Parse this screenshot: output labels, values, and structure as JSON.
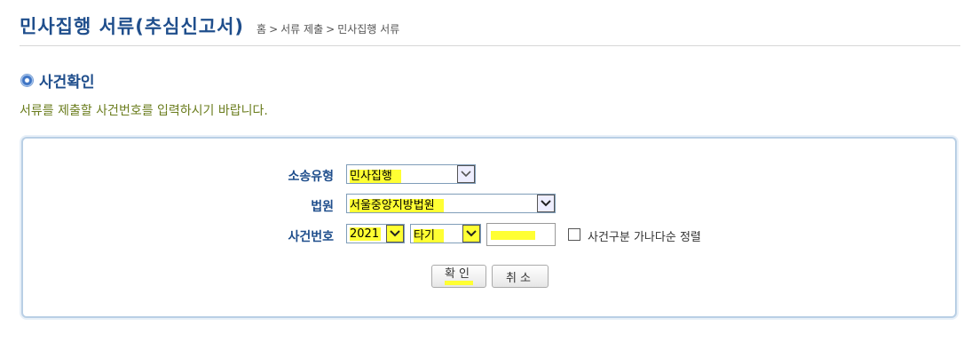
{
  "header": {
    "title": "민사집행 서류(추심신고서)",
    "breadcrumb": [
      "홈",
      "서류 제출",
      "민사집행 서류"
    ],
    "breadcrumb_sep": ">"
  },
  "section": {
    "title": "사건확인",
    "instruction": "서류를 제출할 사건번호를 입력하시기 바랍니다."
  },
  "form": {
    "case_type_label": "소송유형",
    "case_type_value": "민사집행",
    "court_label": "법원",
    "court_value": "서울중앙지방법원",
    "case_number_label": "사건번호",
    "year_value": "2021",
    "case_kind_value": "타기",
    "case_serial_value": "",
    "sort_checkbox_label": "사건구분 가나다순 정렬",
    "sort_checked": false
  },
  "buttons": {
    "confirm": "확인",
    "cancel": "취소"
  },
  "colors": {
    "title": "#1f4e8c",
    "instruction": "#6b7d1e",
    "highlight": "#ffff33",
    "panel_border": "#b9cfe5"
  },
  "icons": [
    "bullet-icon",
    "chevron-down-icon",
    "checkbox-icon"
  ]
}
